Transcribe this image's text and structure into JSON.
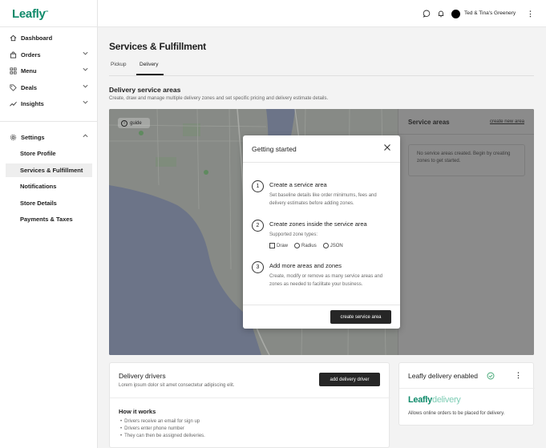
{
  "brand": {
    "logo": "Leafly",
    "trademark": "ᴿᴹ",
    "accent": "#0e8a6a"
  },
  "topbar": {
    "store_name": "Ted & Tina's Greenery"
  },
  "sidebar": {
    "items": [
      {
        "label": "Dashboard",
        "icon": "home-icon"
      },
      {
        "label": "Orders",
        "icon": "bag-icon"
      },
      {
        "label": "Menu",
        "icon": "grid-icon"
      },
      {
        "label": "Deals",
        "icon": "tag-icon"
      },
      {
        "label": "Insights",
        "icon": "trend-icon"
      }
    ],
    "settings": {
      "label": "Settings",
      "icon": "gear-icon",
      "sub": [
        "Store Profile",
        "Services & Fulfillment",
        "Notifications",
        "Store Details",
        "Payments & Taxes"
      ],
      "active": "Services & Fulfillment"
    }
  },
  "page": {
    "title": "Services & Fulfillment",
    "tabs": [
      "Pickup",
      "Delivery"
    ],
    "active_tab": "Delivery",
    "section_title": "Delivery service areas",
    "section_sub": "Create, draw and manage multiple delivery zones and set specific pricing and delivery estimate details."
  },
  "map": {
    "guide_label": "guide",
    "areas_title": "Service areas",
    "areas_link": "create new area",
    "areas_empty": "No service areas created. Begin by creating zones to get started."
  },
  "modal": {
    "title": "Getting started",
    "steps": [
      {
        "num": "1",
        "title": "Create a service area",
        "desc": "Set baseline details like order minimums, fees and delivery estimates before adding zones."
      },
      {
        "num": "2",
        "title": "Create zones inside the service area",
        "desc": "Supported zone types:"
      },
      {
        "num": "3",
        "title": "Add more areas and zones",
        "desc": "Create, modify or remove as many service areas and zones as needed to facilitate your business."
      }
    ],
    "zone_types": [
      "Draw",
      "Radius",
      "JSON"
    ],
    "button": "create service area"
  },
  "drivers": {
    "title": "Delivery drivers",
    "sub": "Lorem ipsum dolor sit amet consectetur adipiscing elit.",
    "button": "add delivery driver",
    "how_title": "How it works",
    "how_items": [
      "Drivers receive an email for sign up",
      "Drivers enter phone number",
      "They can then be assigned deliveries."
    ]
  },
  "delivery": {
    "title": "Leafly delivery enabled",
    "logo_main": "Leafly",
    "logo_light": "delivery",
    "text": "Allows online orders to be placed for delivery."
  }
}
